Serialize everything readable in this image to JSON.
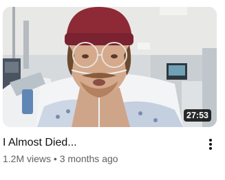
{
  "video": {
    "title": "I Almost Died...",
    "views": "1.2M views",
    "separator": "•",
    "age": "3 months ago",
    "duration": "27:53"
  },
  "icons": {
    "menu": "more-vert-icon"
  },
  "colors": {
    "title": "#0f0f0f",
    "meta": "#606060",
    "duration_bg": "#000000",
    "duration_text": "#ffffff"
  }
}
